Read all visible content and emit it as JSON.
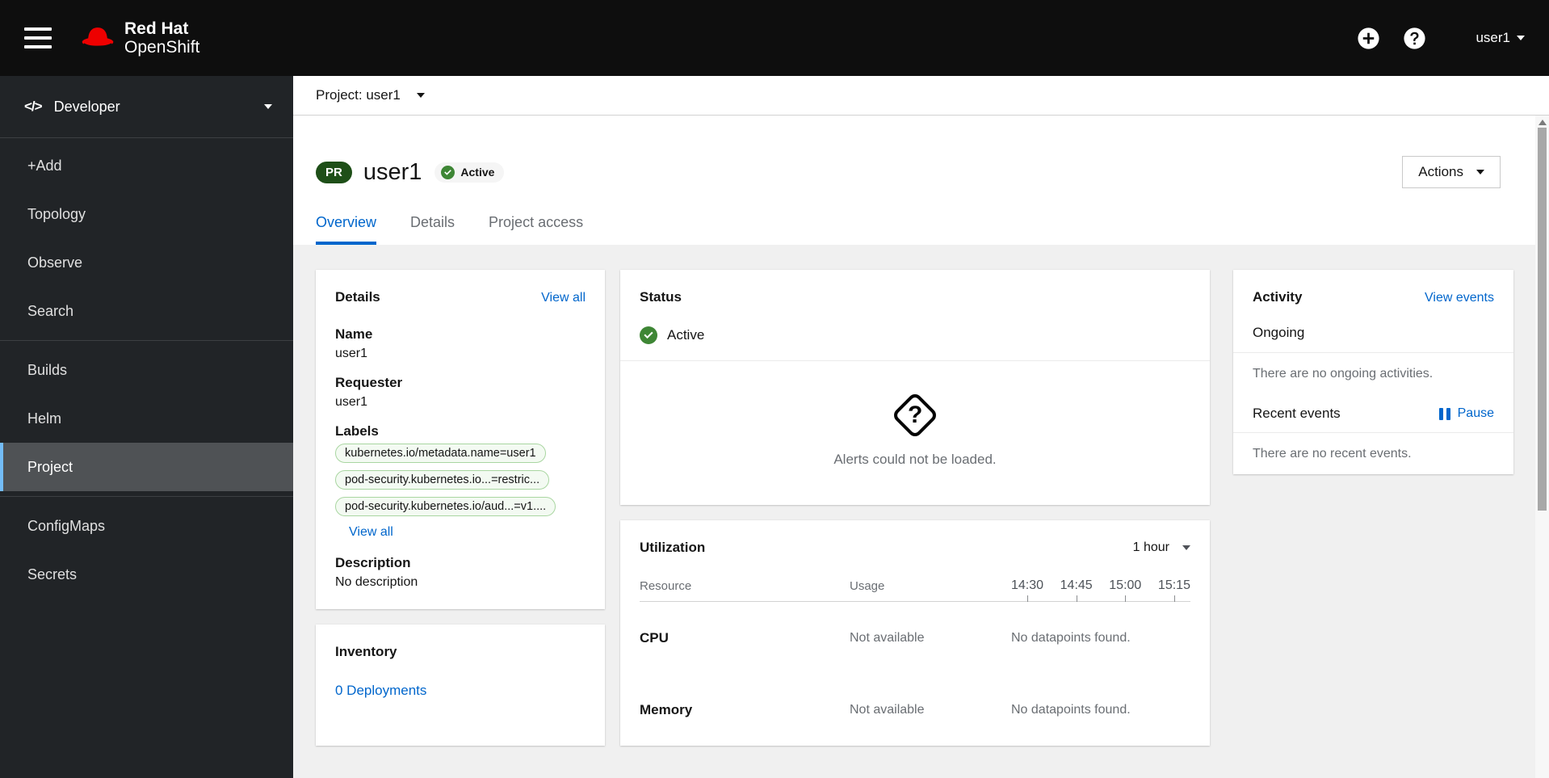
{
  "colors": {
    "accent_blue": "#0066cc",
    "status_green": "#3e8635",
    "project_badge_green": "#1e4f18",
    "label_pill_bg": "#f3faf2",
    "label_pill_border": "#a9d6a1",
    "nav_selected_indicator": "#73bcf7",
    "masthead_bg": "#0e0e0e",
    "sidebar_bg": "#212427"
  },
  "icons": {
    "menu": "hamburger",
    "brand": "red-hat-fedora",
    "quick_add": "plus-circle",
    "help": "question-circle",
    "user_caret": "caret-down",
    "status_active": "check-circle",
    "alerts_unknown": "question-diamond",
    "pause": "pause-bars",
    "code": "code-brackets"
  },
  "masthead": {
    "brand_line1": "Red Hat",
    "brand_line2": "OpenShift",
    "user_menu": "user1"
  },
  "sidebar": {
    "perspective": {
      "icon_text": "</>",
      "label": "Developer"
    },
    "sections": [
      {
        "items": [
          "+Add",
          "Topology",
          "Observe",
          "Search"
        ]
      },
      {
        "items": [
          "Builds",
          "Helm",
          "Project"
        ]
      },
      {
        "items": [
          "ConfigMaps",
          "Secrets"
        ]
      }
    ],
    "selected_item": "Project"
  },
  "project_bar": {
    "label": "Project: user1"
  },
  "page_header": {
    "badge": "PR",
    "title": "user1",
    "status_badge": "Active",
    "actions_label": "Actions"
  },
  "tabs": [
    {
      "label": "Overview",
      "active": true
    },
    {
      "label": "Details",
      "active": false
    },
    {
      "label": "Project access",
      "active": false
    }
  ],
  "details_card": {
    "title": "Details",
    "view_all_link": "View all",
    "fields": [
      {
        "term": "Name",
        "value": "user1"
      },
      {
        "term": "Requester",
        "value": "user1"
      }
    ],
    "labels_term": "Labels",
    "labels": [
      "kubernetes.io/metadata.name=user1",
      "pod-security.kubernetes.io...=restric...",
      "pod-security.kubernetes.io/aud...=v1...."
    ],
    "labels_view_all": "View all",
    "description_term": "Description",
    "description_value": "No description"
  },
  "status_card": {
    "title": "Status",
    "status": "Active",
    "alerts_message": "Alerts could not be loaded."
  },
  "utilization_card": {
    "title": "Utilization",
    "duration": "1 hour",
    "columns": {
      "resource": "Resource",
      "usage": "Usage"
    },
    "times": [
      "14:30",
      "14:45",
      "15:00",
      "15:15"
    ],
    "rows": [
      {
        "resource": "CPU",
        "usage": "Not available",
        "data": "No datapoints found."
      },
      {
        "resource": "Memory",
        "usage": "Not available",
        "data": "No datapoints found."
      }
    ]
  },
  "activity_card": {
    "title": "Activity",
    "view_events_link": "View events",
    "ongoing_heading": "Ongoing",
    "ongoing_empty": "There are no ongoing activities.",
    "recent_heading": "Recent events",
    "pause_label": "Pause",
    "recent_empty": "There are no recent events."
  },
  "inventory_card": {
    "title": "Inventory",
    "deployments_link": "0 Deployments"
  }
}
